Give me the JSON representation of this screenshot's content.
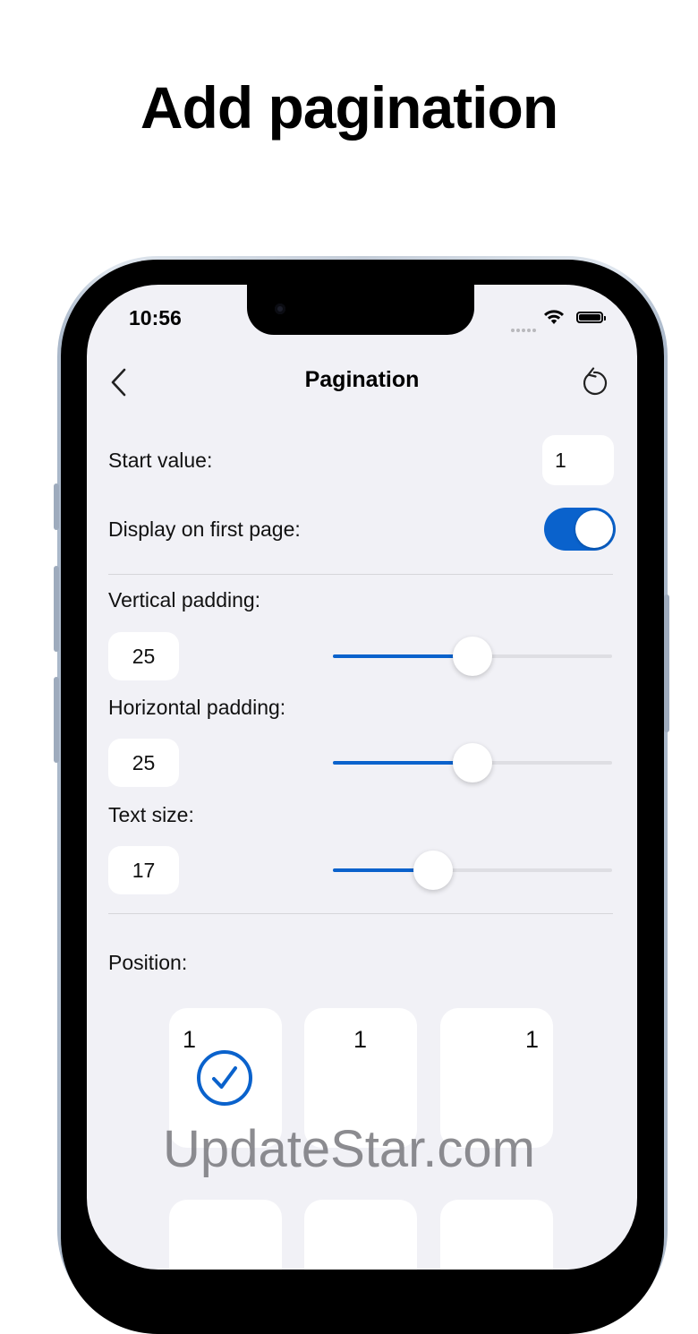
{
  "headline": "Add pagination",
  "status_bar": {
    "time": "10:56"
  },
  "nav": {
    "title": "Pagination",
    "back_icon": "chevron-left-icon",
    "reset_icon": "undo-icon"
  },
  "settings": {
    "start_value": {
      "label": "Start value:",
      "value": "1"
    },
    "display_first_page": {
      "label": "Display on first page:",
      "on": true
    },
    "vertical_padding": {
      "label": "Vertical padding:",
      "value": "25",
      "level": 0.5
    },
    "horizontal_padding": {
      "label": "Horizontal padding:",
      "value": "25",
      "level": 0.5
    },
    "text_size": {
      "label": "Text size:",
      "value": "17",
      "level": 0.36
    }
  },
  "position": {
    "label": "Position:",
    "options": [
      {
        "number": "1",
        "align": "left",
        "selected": true
      },
      {
        "number": "1",
        "align": "center",
        "selected": false
      },
      {
        "number": "1",
        "align": "right",
        "selected": false
      }
    ]
  },
  "colors": {
    "accent": "#0a62cc",
    "background": "#f1f1f6"
  },
  "watermark": "UpdateStar.com"
}
